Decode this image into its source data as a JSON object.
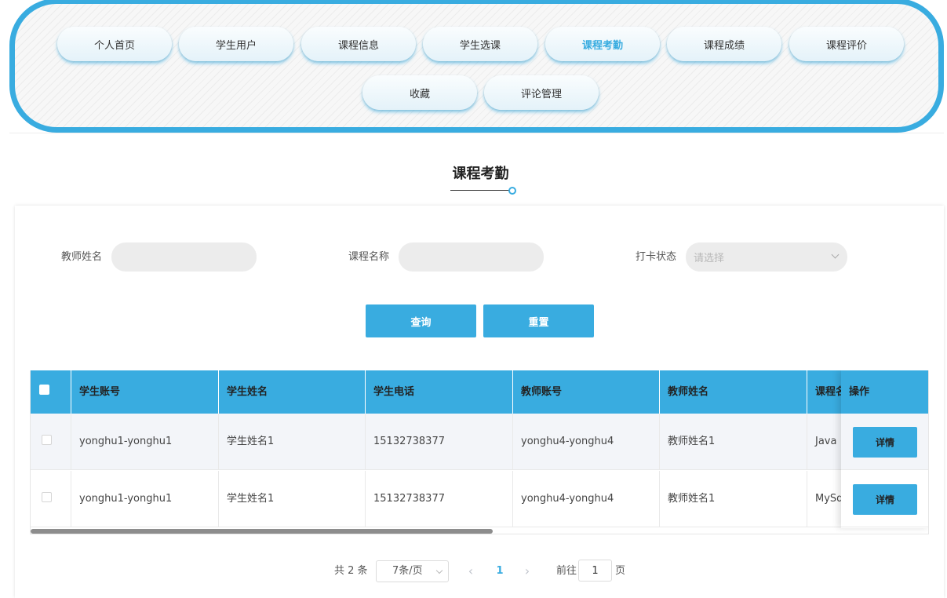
{
  "nav": {
    "items": [
      "个人首页",
      "学生用户",
      "课程信息",
      "学生选课",
      "课程考勤",
      "课程成绩",
      "课程评价",
      "收藏",
      "评论管理"
    ],
    "active": "课程考勤"
  },
  "page_title": "课程考勤",
  "search": {
    "teacher_label": "教师姓名",
    "teacher_value": "",
    "course_label": "课程名称",
    "course_value": "",
    "status_label": "打卡状态",
    "status_placeholder": "请选择",
    "query_button": "查询",
    "reset_button": "重置"
  },
  "table": {
    "columns": [
      "学生账号",
      "学生姓名",
      "学生电话",
      "教师账号",
      "教师姓名",
      "课程名称"
    ],
    "action_header": "操作",
    "rows": [
      {
        "student_account": "yonghu1-yonghu1",
        "student_name": "学生姓名1",
        "student_phone": "15132738377",
        "teacher_account": "yonghu4-yonghu4",
        "teacher_name": "教师姓名1",
        "course_name": "Java",
        "action": "详情"
      },
      {
        "student_account": "yonghu1-yonghu1",
        "student_name": "学生姓名1",
        "student_phone": "15132738377",
        "teacher_account": "yonghu4-yonghu4",
        "teacher_name": "教师姓名1",
        "course_name": "MySql",
        "action": "详情"
      }
    ]
  },
  "pagination": {
    "total_text": "共 2 条",
    "page_size": "7条/页",
    "current_page": "1",
    "goto_label": "前往",
    "goto_value": "1",
    "page_suffix": "页"
  },
  "colors": {
    "accent": "#39ace0"
  }
}
